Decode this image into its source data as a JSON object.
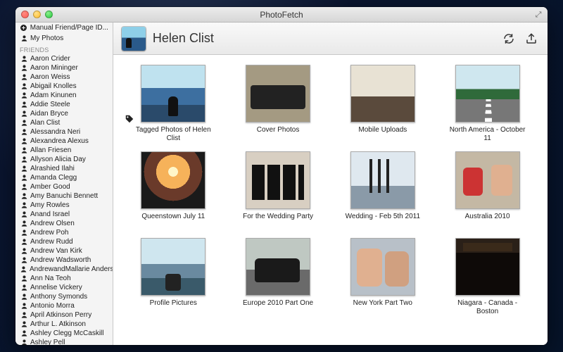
{
  "window": {
    "title": "PhotoFetch"
  },
  "sidebar": {
    "manual_label": "Manual Friend/Page ID...",
    "my_photos_label": "My Photos",
    "section_label": "FRIENDS",
    "friends": [
      "Aaron Crider",
      "Aaron Mininger",
      "Aaron Weiss",
      "Abigail Knolles",
      "Adam Kinunen",
      "Addie Steele",
      "Aidan Bryce",
      "Alan Clist",
      "Alessandra Neri",
      "Alexandrea Alexus",
      "Allan Friesen",
      "Allyson Alicia Day",
      "Alrashied Ilahi",
      "Amanda Clegg",
      "Amber Good",
      "Amy Banuchi Bennett",
      "Amy Rowles",
      "Anand Israel",
      "Andrew Olsen",
      "Andrew Poh",
      "Andrew Rudd",
      "Andrew Van Kirk",
      "Andrew Wadsworth",
      "AndrewandMallarie Andersen",
      "Ann Na Teoh",
      "Annelise Vickery",
      "Anthony Symonds",
      "Antonio Morra",
      "April Atkinson Perry",
      "Arthur L. Atkinson",
      "Ashley Clegg McCaskill",
      "Ashley Pell"
    ]
  },
  "header": {
    "person_name": "Helen Clist"
  },
  "albums": [
    {
      "title": "Tagged Photos of Helen Clist",
      "thumb": "t-mountain-person",
      "tagged": true
    },
    {
      "title": "Cover Photos",
      "thumb": "t-group"
    },
    {
      "title": "Mobile Uploads",
      "thumb": "t-meeting"
    },
    {
      "title": "North America - October 11",
      "thumb": "t-road"
    },
    {
      "title": "Queenstown July 11",
      "thumb": "t-sunset"
    },
    {
      "title": "For the Wedding Party",
      "thumb": "t-dresses"
    },
    {
      "title": "Wedding - Feb 5th 2011",
      "thumb": "t-ship"
    },
    {
      "title": "Australia 2010",
      "thumb": "t-kids"
    },
    {
      "title": "Profile Pictures",
      "thumb": "t-seat-mountain"
    },
    {
      "title": "Europe 2010 Part One",
      "thumb": "t-car"
    },
    {
      "title": "New York Part Two",
      "thumb": "t-couple"
    },
    {
      "title": "Niagara - Canada - Boston",
      "thumb": "t-dark"
    }
  ]
}
